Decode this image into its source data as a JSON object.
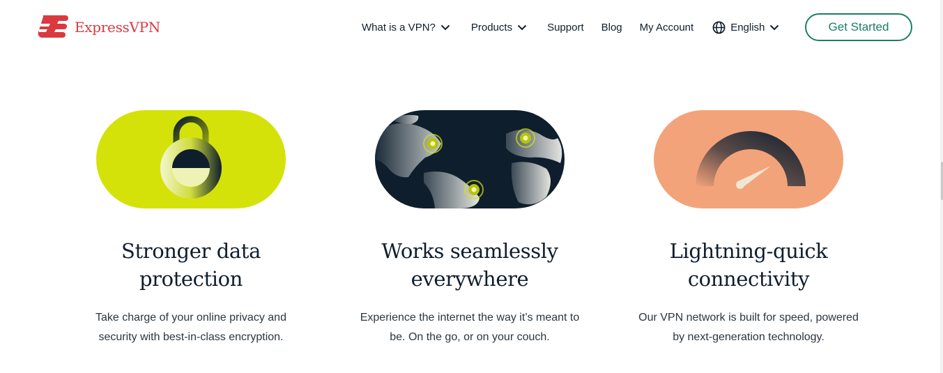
{
  "brand": {
    "name": "ExpressVPN",
    "color": "#da3940",
    "logo_icon": "expressvpn-logo-icon"
  },
  "nav": {
    "items": [
      {
        "label": "What is a VPN?",
        "has_dropdown": true
      },
      {
        "label": "Products",
        "has_dropdown": true
      },
      {
        "label": "Support",
        "has_dropdown": false
      },
      {
        "label": "Blog",
        "has_dropdown": false
      },
      {
        "label": "My Account",
        "has_dropdown": false
      },
      {
        "label": "English",
        "has_dropdown": true,
        "icon": "globe-icon"
      }
    ],
    "cta_label": "Get Started",
    "cta_color": "#1a7f64"
  },
  "features": [
    {
      "illustration": "padlock-icon",
      "background": "#d4e20a",
      "title_line1": "Stronger data",
      "title_line2": "protection",
      "desc_line1": "Take charge of your online privacy and",
      "desc_line2": "security with best-in-class encryption."
    },
    {
      "illustration": "world-map-icon",
      "background": "#0f1e2c",
      "title_line1": "Works seamlessly",
      "title_line2": "everywhere",
      "desc_line1": "Experience the internet the way it’s meant to",
      "desc_line2": "be. On the go, or on your couch."
    },
    {
      "illustration": "speedometer-icon",
      "background": "#f3a37a",
      "title_line1": "Lightning-quick",
      "title_line2": "connectivity",
      "desc_line1": "Our VPN network is built for speed, powered",
      "desc_line2": "by next-generation technology."
    }
  ]
}
